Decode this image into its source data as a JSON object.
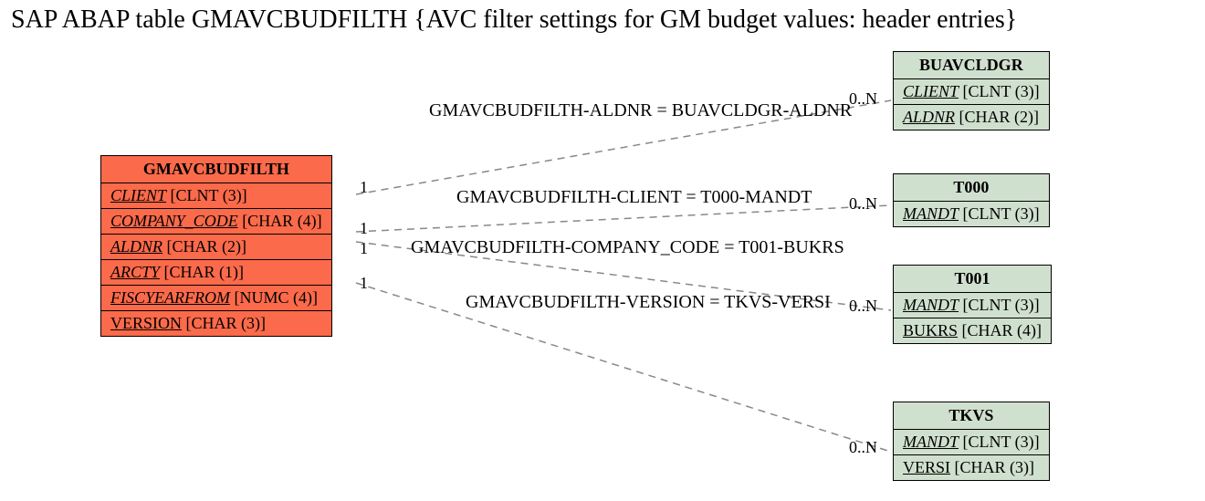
{
  "title": "SAP ABAP table GMAVCBUDFILTH {AVC filter settings for GM budget values: header entries}",
  "main": {
    "name": "GMAVCBUDFILTH",
    "fields": [
      {
        "name": "CLIENT",
        "type": "[CLNT (3)]",
        "key": true
      },
      {
        "name": "COMPANY_CODE",
        "type": "[CHAR (4)]",
        "key": true
      },
      {
        "name": "ALDNR",
        "type": "[CHAR (2)]",
        "key": true
      },
      {
        "name": "ARCTY",
        "type": "[CHAR (1)]",
        "key": true
      },
      {
        "name": "FISCYEARFROM",
        "type": "[NUMC (4)]",
        "key": true
      },
      {
        "name": "VERSION",
        "type": "[CHAR (3)]",
        "key": false
      }
    ]
  },
  "refs": [
    {
      "name": "BUAVCLDGR",
      "fields": [
        {
          "name": "CLIENT",
          "type": "[CLNT (3)]",
          "key": true
        },
        {
          "name": "ALDNR",
          "type": "[CHAR (2)]",
          "key": true
        }
      ]
    },
    {
      "name": "T000",
      "fields": [
        {
          "name": "MANDT",
          "type": "[CLNT (3)]",
          "key": true
        }
      ]
    },
    {
      "name": "T001",
      "fields": [
        {
          "name": "MANDT",
          "type": "[CLNT (3)]",
          "key": true
        },
        {
          "name": "BUKRS",
          "type": "[CHAR (4)]",
          "key": false
        }
      ]
    },
    {
      "name": "TKVS",
      "fields": [
        {
          "name": "MANDT",
          "type": "[CLNT (3)]",
          "key": true
        },
        {
          "name": "VERSI",
          "type": "[CHAR (3)]",
          "key": false
        }
      ]
    }
  ],
  "rels": [
    {
      "label": "GMAVCBUDFILTH-ALDNR = BUAVCLDGR-ALDNR",
      "left": "1",
      "right": "0..N"
    },
    {
      "label": "GMAVCBUDFILTH-CLIENT = T000-MANDT",
      "left": "1",
      "right": "0..N"
    },
    {
      "label": "GMAVCBUDFILTH-COMPANY_CODE = T001-BUKRS",
      "left": "1",
      "right": "0..N"
    },
    {
      "label": "GMAVCBUDFILTH-VERSION = TKVS-VERSI",
      "left": "1",
      "right": "0..N"
    }
  ]
}
